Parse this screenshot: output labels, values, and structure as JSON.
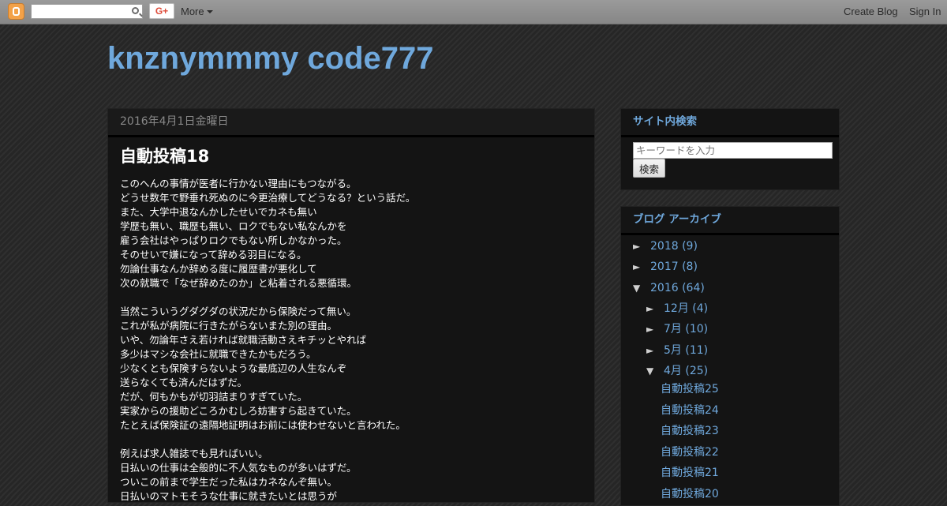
{
  "navbar": {
    "more_label": "More",
    "gplus_label": "G+",
    "create_blog": "Create Blog",
    "sign_in": "Sign In"
  },
  "blog": {
    "title": "knznymmmy code777"
  },
  "post": {
    "date": "2016年4月1日金曜日",
    "title": "自動投稿18",
    "paragraphs": [
      [
        "このへんの事情が医者に行かない理由にもつながる。",
        "どうせ数年で野垂れ死ぬのに今更治療してどうなる？という話だ。",
        "また、大学中退なんかしたせいでカネも無い",
        "学歴も無い、職歴も無い、ロクでもない私なんかを",
        "雇う会社はやっぱりロクでもない所しかなかった。",
        "そのせいで嫌になって辞める羽目になる。",
        "勿論仕事なんか辞める度に履歴書が悪化して",
        "次の就職で「なぜ辞めたのか」と粘着される悪循環。"
      ],
      [
        "当然こういうグダグダの状況だから保険だって無い。",
        "これが私が病院に行きたがらないまた別の理由。",
        "いや、勿論年さえ若ければ就職活動さえキチッとやれば",
        "多少はマシな会社に就職できたかもだろう。",
        "少なくとも保険すらないような最底辺の人生なんぞ",
        "送らなくても済んだはずだ。",
        "だが、何もかもが切羽詰まりすぎていた。",
        "実家からの援助どころかむしろ妨害すら起きていた。",
        "たとえば保険証の遠隔地証明はお前には使わせないと言われた。"
      ],
      [
        "例えば求人雑誌でも見ればいい。",
        "日払いの仕事は全般的に不人気なものが多いはずだ。",
        "ついこの前まで学生だった私はカネなんぞ無い。",
        "日払いのマトモそうな仕事に就きたいとは思うが"
      ]
    ]
  },
  "sidebar": {
    "search": {
      "title": "サイト内検索",
      "placeholder": "キーワードを入力",
      "button": "検索"
    },
    "archive": {
      "title": "ブログ アーカイブ",
      "years": [
        {
          "toggle": "►",
          "label": "2018 (9)"
        },
        {
          "toggle": "►",
          "label": "2017 (8)"
        },
        {
          "toggle": "▼",
          "label": "2016 (64)"
        }
      ],
      "months": [
        {
          "toggle": "►",
          "label": "12月 (4)"
        },
        {
          "toggle": "►",
          "label": "7月 (10)"
        },
        {
          "toggle": "►",
          "label": "5月 (11)"
        },
        {
          "toggle": "▼",
          "label": "4月 (25)"
        }
      ],
      "posts": [
        "自動投稿25",
        "自動投稿24",
        "自動投稿23",
        "自動投稿22",
        "自動投稿21",
        "自動投稿20"
      ]
    }
  },
  "colors": {
    "link": "#6fa8dc",
    "background": "#2a2a2a",
    "panel": "#141414"
  }
}
